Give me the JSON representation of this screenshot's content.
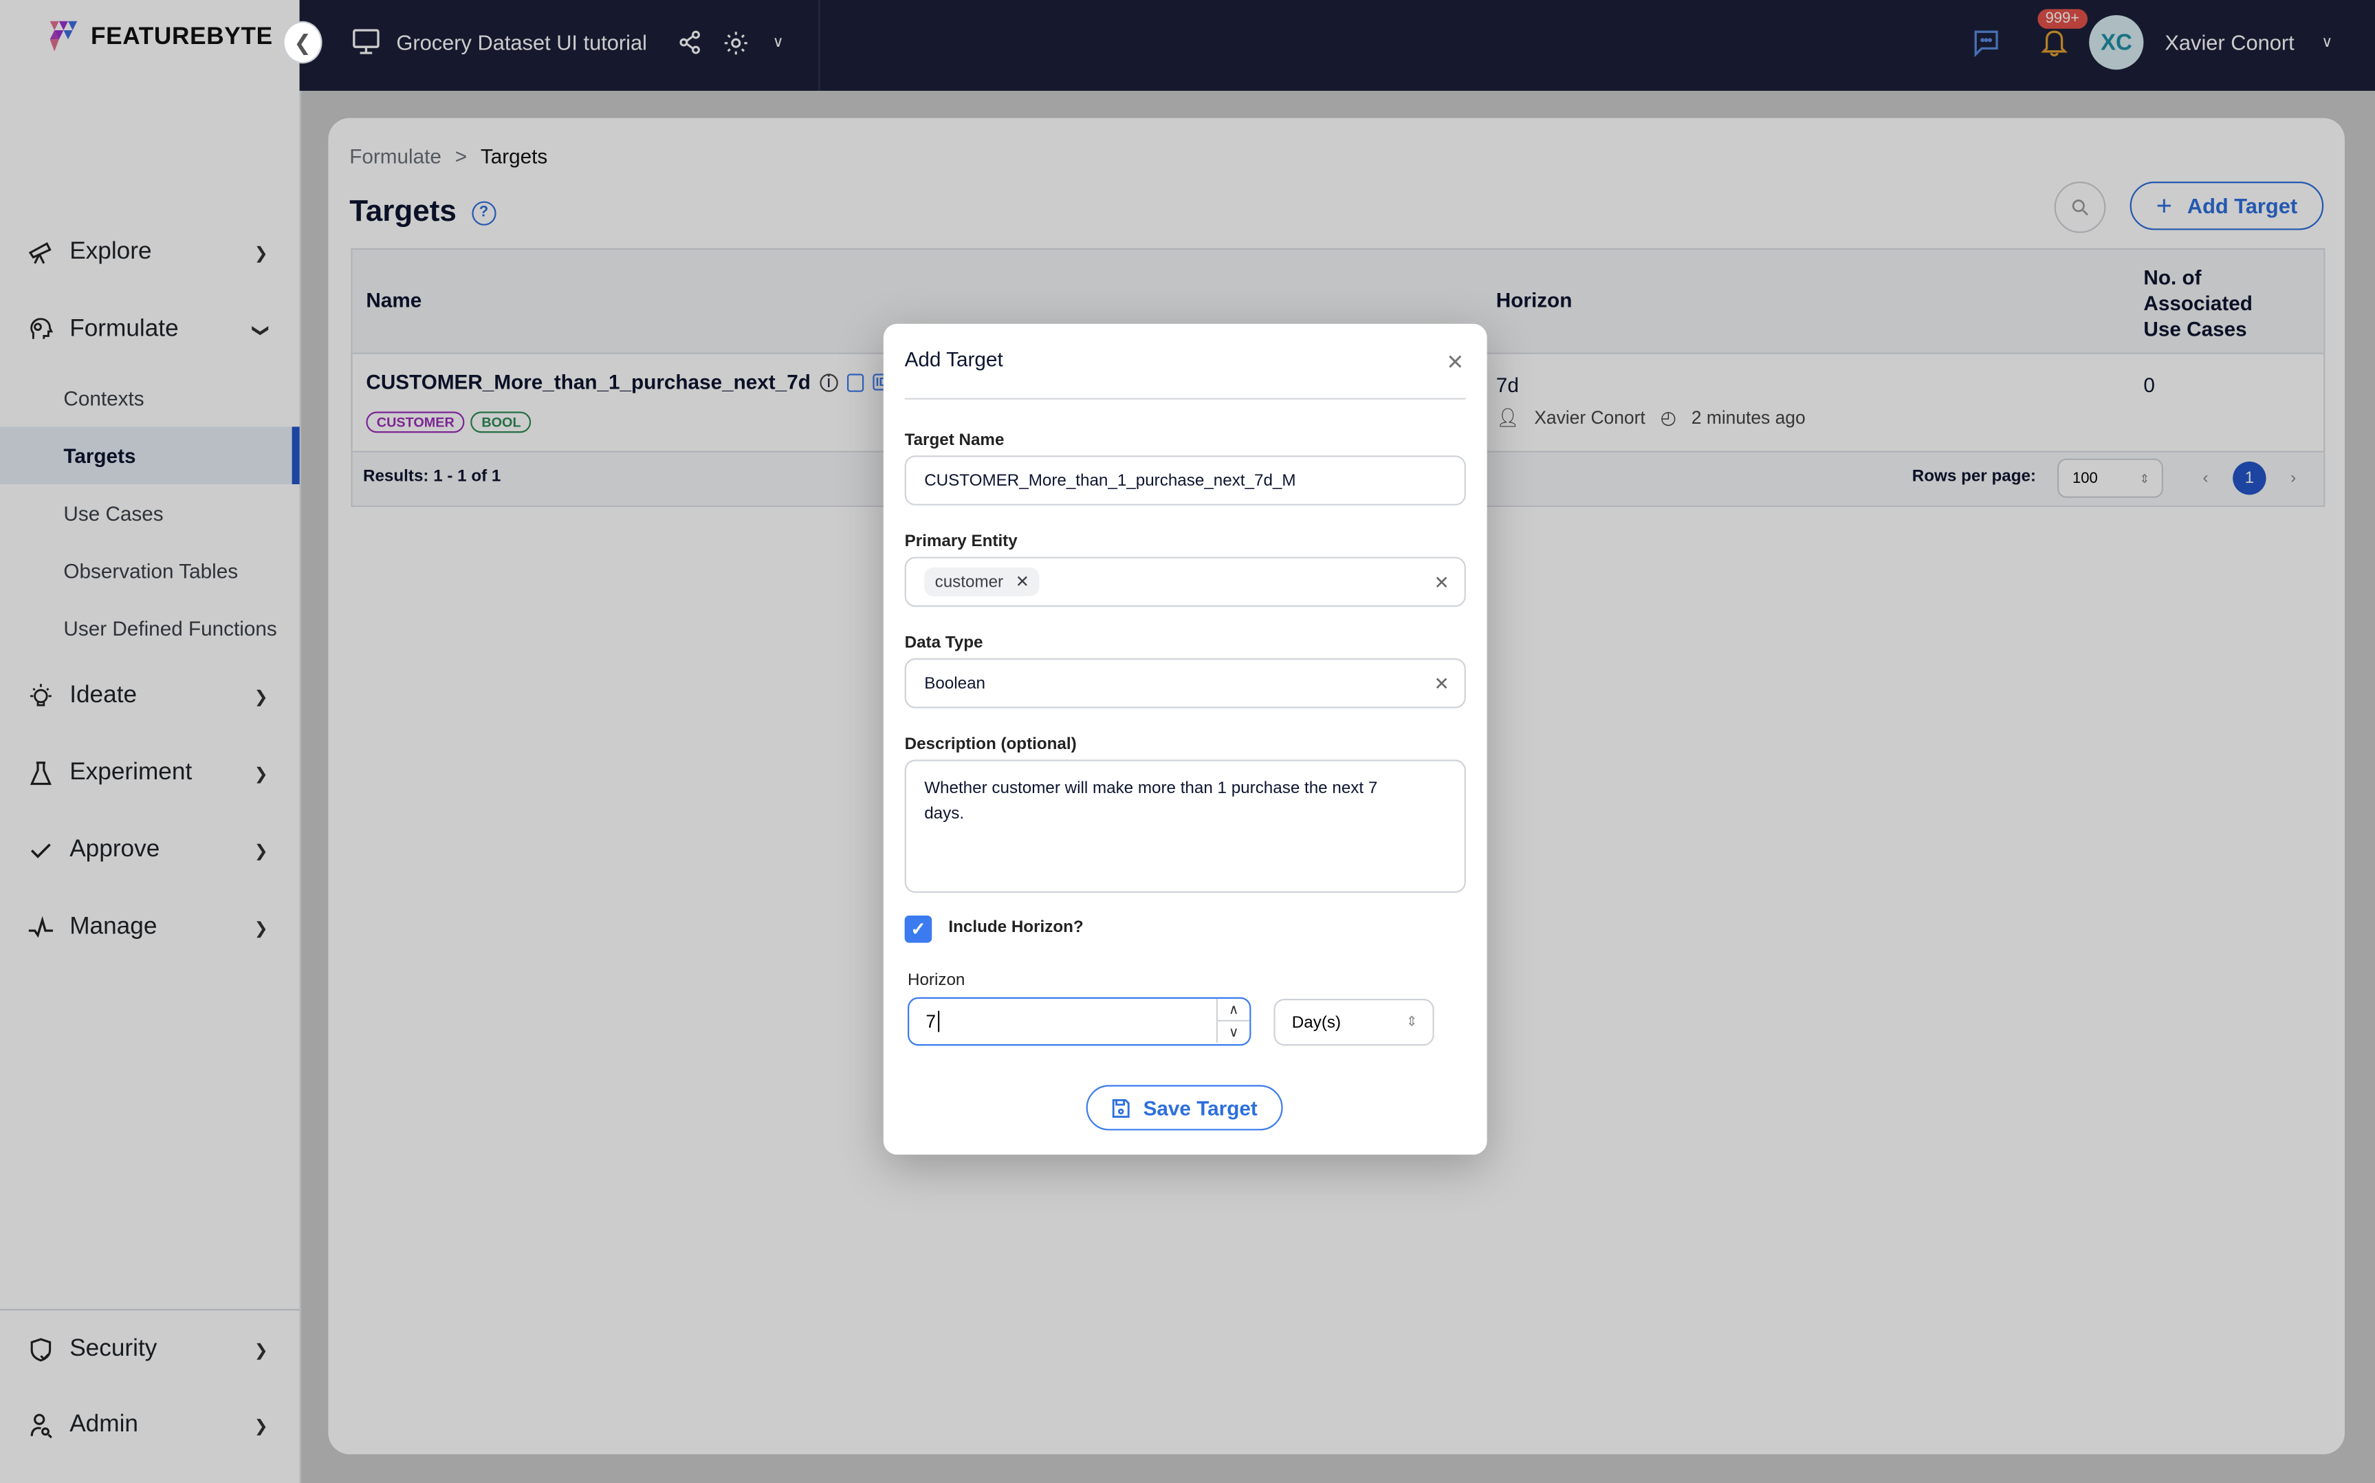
{
  "app": {
    "logo": "FEATUREBYTE",
    "project": "Grocery Dataset UI tutorial"
  },
  "header": {
    "notifications_badge": "999+",
    "avatar_initials": "XC",
    "user_name": "Xavier Conort"
  },
  "sidebar": {
    "items": [
      {
        "label": "Explore",
        "icon": "telescope-icon"
      },
      {
        "label": "Formulate",
        "icon": "head-gear-icon"
      },
      {
        "label": "Ideate",
        "icon": "lightbulb-icon"
      },
      {
        "label": "Experiment",
        "icon": "flask-icon"
      },
      {
        "label": "Approve",
        "icon": "check-icon"
      },
      {
        "label": "Manage",
        "icon": "pulse-icon"
      },
      {
        "label": "Security",
        "icon": "shield-icon"
      },
      {
        "label": "Admin",
        "icon": "user-search-icon"
      }
    ],
    "subitems": [
      "Contexts",
      "Targets",
      "Use Cases",
      "Observation Tables",
      "User Defined Functions"
    ]
  },
  "breadcrumb": {
    "parent": "Formulate",
    "separator": ">",
    "current": "Targets"
  },
  "page": {
    "title": "Targets",
    "add_button": "Add Target"
  },
  "table": {
    "headers": {
      "name": "Name",
      "horizon": "Horizon",
      "use_cases": "No. of Associated Use Cases"
    },
    "rows": [
      {
        "name": "CUSTOMER_More_than_1_purchase_next_7d",
        "tags": [
          "CUSTOMER",
          "BOOL"
        ],
        "horizon": "7d",
        "author": "Xavier Conort",
        "time": "2 minutes ago",
        "use_cases": "0"
      }
    ],
    "results": "Results: 1 - 1 of 1",
    "rows_per_page_label": "Rows per page:",
    "rows_per_page": "100",
    "current_page": "1"
  },
  "modal": {
    "title": "Add Target",
    "target_name_label": "Target Name",
    "target_name": "CUSTOMER_More_than_1_purchase_next_7d_M",
    "primary_entity_label": "Primary Entity",
    "primary_entity_chip": "customer",
    "data_type_label": "Data Type",
    "data_type": "Boolean",
    "description_label": "Description (optional)",
    "description": "Whether customer will make more than 1 purchase the next 7 days.",
    "include_horizon_label": "Include Horizon?",
    "include_horizon": true,
    "horizon_label": "Horizon",
    "horizon_value": "7",
    "horizon_unit": "Day(s)",
    "save_button": "Save Target"
  }
}
